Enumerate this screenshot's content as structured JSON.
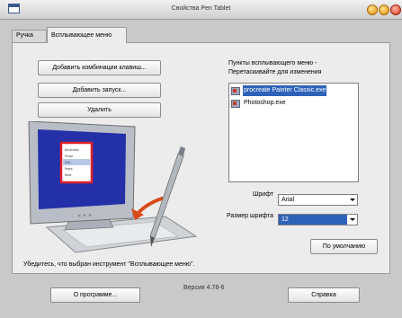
{
  "window": {
    "title": "Свойства Pen Tablet"
  },
  "tabs": [
    {
      "label": "Ручка"
    },
    {
      "label": "Всплывающее меню"
    }
  ],
  "buttons": {
    "add_keystroke": "Добавить комбинации клавиш...",
    "add_launch": "Добавить запуск...",
    "delete": "Удалить",
    "defaults": "По умолчанию",
    "about": "О программе...",
    "help": "Справка"
  },
  "list": {
    "caption_line1": "Пункты всплывающего меню -",
    "caption_line2": "Перетаскивайте для изменения",
    "items": [
      {
        "label": "procreate Painter Classic.exe",
        "selected": true,
        "icon": "application-icon"
      },
      {
        "label": "Photoshop.exe",
        "selected": false,
        "icon": "application-icon"
      }
    ]
  },
  "font": {
    "label": "Шрифт",
    "value": "Arial",
    "size_label": "Размер шрифта",
    "size_value": "12"
  },
  "hint": "Убедитесь, что выбран инструмент \"Всплывающее меню\".",
  "version": "Версия 4.78-6",
  "illustration": {
    "icon": "monitor-tablet-pen-illustration",
    "menu_items": [
      "Keystroke",
      "Photo",
      "Edit",
      "Paste",
      "Next"
    ]
  },
  "colors": {
    "selection": "#2e62b8",
    "arrow": "#d94a1a",
    "screen": "#2430a8",
    "menu_border": "#e0202a"
  }
}
